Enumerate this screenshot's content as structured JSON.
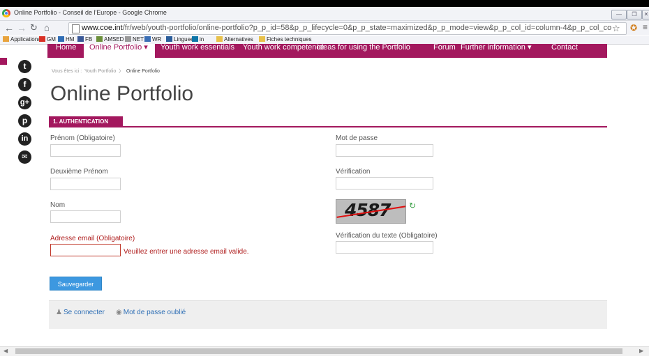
{
  "window": {
    "title": "Online Portfolio - Conseil de l'Europe - Google Chrome",
    "controls": [
      "—",
      "❒",
      "✕"
    ]
  },
  "toolbar": {
    "url_host": "www.coe.int",
    "url_path": "/fr/web/youth-portfolio/online-portfolio?p_p_id=58&p_p_lifecycle=0&p_p_state=maximized&p_p_mode=view&p_p_col_id=column-4&p_p_col_co"
  },
  "bookmarks": [
    {
      "label": "Applications",
      "color": "#e8a33d"
    },
    {
      "label": "GM",
      "color": "#d93025"
    },
    {
      "label": "HM",
      "color": "#2f6db5"
    },
    {
      "label": "FB",
      "color": "#3b5998"
    },
    {
      "label": "AMSED",
      "color": "#6b8f3a"
    },
    {
      "label": "NET",
      "color": "#999999"
    },
    {
      "label": "WR",
      "color": "#3b6fb5"
    },
    {
      "label": "Linguee",
      "color": "#2b5d9a"
    },
    {
      "label": "in",
      "color": "#0e76a8"
    },
    {
      "label": "Alternatives",
      "color": "#e8c14a"
    },
    {
      "label": "Fiches techniques",
      "color": "#e8c14a"
    }
  ],
  "nav": {
    "items": [
      "Home",
      "Online Portfolio ▾",
      "Youth work essentials",
      "Youth work competence",
      "Ideas for using the Portfolio",
      "Forum",
      "Further information ▾",
      "Contact"
    ],
    "accent": "#a3185e"
  },
  "social": [
    "twitter-icon",
    "facebook-icon",
    "google-plus-icon",
    "pinterest-icon",
    "linkedin-icon",
    "email-icon"
  ],
  "breadcrumb": {
    "prefix": "Vous êtes ici :",
    "items": [
      "Youth Portfolio",
      "Online Portfolio"
    ],
    "separator": "〉"
  },
  "page": {
    "title": "Online Portfolio",
    "section": "1. AUTHENTICATION"
  },
  "form": {
    "prenom_label": "Prénom (Obligatoire)",
    "deuxieme_label": "Deuxième Prénom",
    "nom_label": "Nom",
    "email_label": "Adresse email (Obligatoire)",
    "email_error": "Veuillez entrer une adresse email valide.",
    "motdepasse_label": "Mot de passe",
    "verification_label": "Vérification",
    "captcha_code": "4587",
    "verif_texte_label": "Vérification du texte (Obligatoire)",
    "save_label": "Sauvegarder"
  },
  "footer": {
    "login_label": "Se connecter",
    "forgot_label": "Mot de passe oublié"
  }
}
